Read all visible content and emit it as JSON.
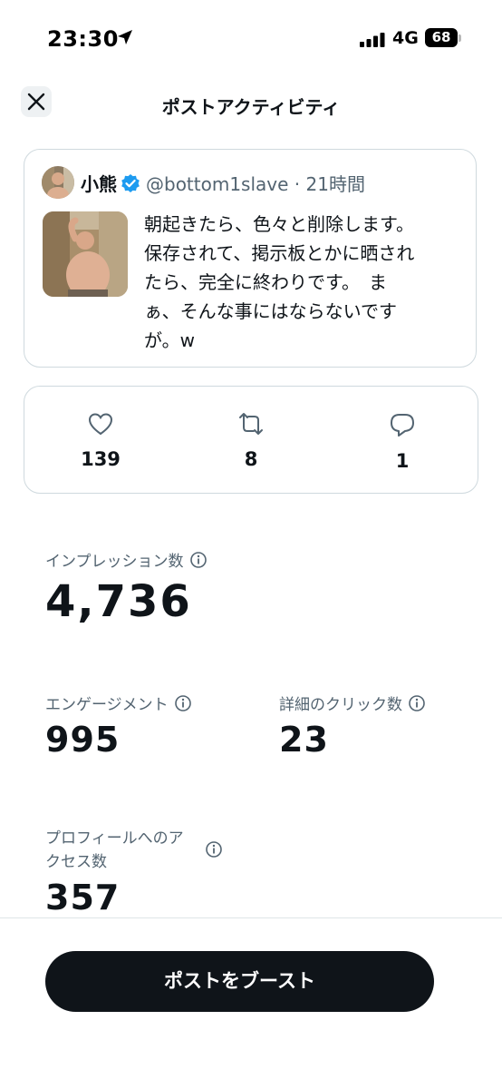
{
  "status_bar": {
    "time": "23:30",
    "network": "4G",
    "battery": "68"
  },
  "header": {
    "title": "ポストアクティビティ"
  },
  "post": {
    "author_name": "小熊",
    "handle": "@bottom1slave",
    "separator": "·",
    "time_ago": "21時間",
    "text": "朝起きたら、色々と削除します。\n保存されて、掲示板とかに晒され\nたら、完全に終わりです。　ま\nぁ、そんな事にはならないです\nが。w"
  },
  "engagement": {
    "likes": "139",
    "reposts": "8",
    "replies": "1"
  },
  "metrics": {
    "impressions_label": "インプレッション数",
    "impressions_value": "4,736",
    "engagements_label": "エンゲージメント",
    "engagements_value": "995",
    "detail_clicks_label": "詳細のクリック数",
    "detail_clicks_value": "23",
    "profile_visits_label": "プロフィールへのア\nクセス数",
    "profile_visits_value": "357"
  },
  "boost_button_label": "ポストをブースト",
  "colors": {
    "accent": "#1d9bf0",
    "text": "#0f1419",
    "secondary": "#536471",
    "border": "#cfd9de",
    "button": "#0f1419"
  }
}
